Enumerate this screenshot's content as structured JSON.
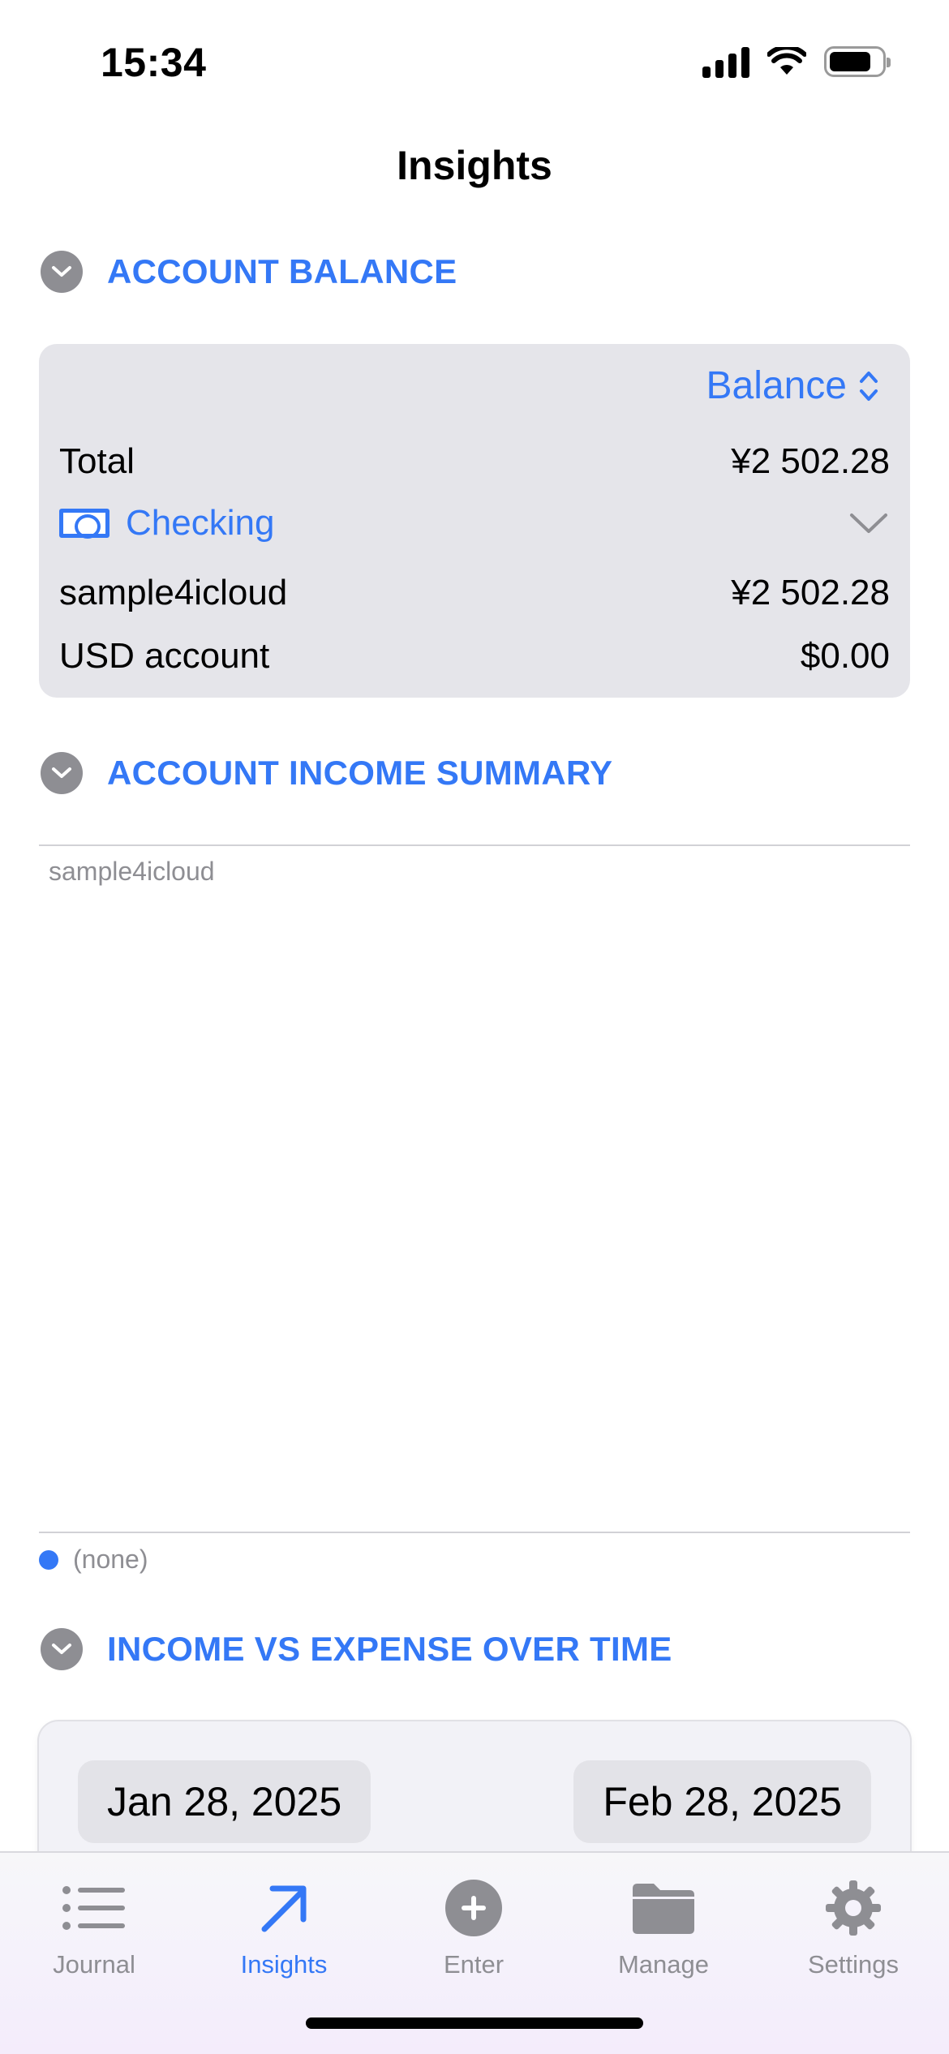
{
  "status_bar": {
    "time": "15:34"
  },
  "nav": {
    "title": "Insights"
  },
  "account_balance": {
    "section_title": "ACCOUNT BALANCE",
    "picker_label": "Balance",
    "total_label": "Total",
    "total_value": "¥2 502.28",
    "group_label": "Checking",
    "accounts": [
      {
        "name": "sample4icloud",
        "value": "¥2 502.28"
      },
      {
        "name": "USD account",
        "value": "$0.00"
      }
    ]
  },
  "income_summary": {
    "section_title": "ACCOUNT INCOME SUMMARY",
    "chart_title": "sample4icloud",
    "legend_label": "(none)",
    "legend_color": "#3478f6"
  },
  "income_vs_expense": {
    "section_title": "INCOME VS EXPENSE OVER TIME",
    "start_date": "Jan 28, 2025",
    "end_date": "Feb 28, 2025"
  },
  "tab_bar": {
    "tabs": [
      {
        "label": "Journal",
        "icon": "list-icon"
      },
      {
        "label": "Insights",
        "icon": "arrow-up-right-icon"
      },
      {
        "label": "Enter",
        "icon": "plus-circle-icon"
      },
      {
        "label": "Manage",
        "icon": "folder-icon"
      },
      {
        "label": "Settings",
        "icon": "gear-icon"
      }
    ],
    "active_tab": "Insights"
  },
  "colors": {
    "accent": "#3478f6",
    "card_background": "#e5e5ea",
    "inactive_tab": "#8e8e93"
  }
}
